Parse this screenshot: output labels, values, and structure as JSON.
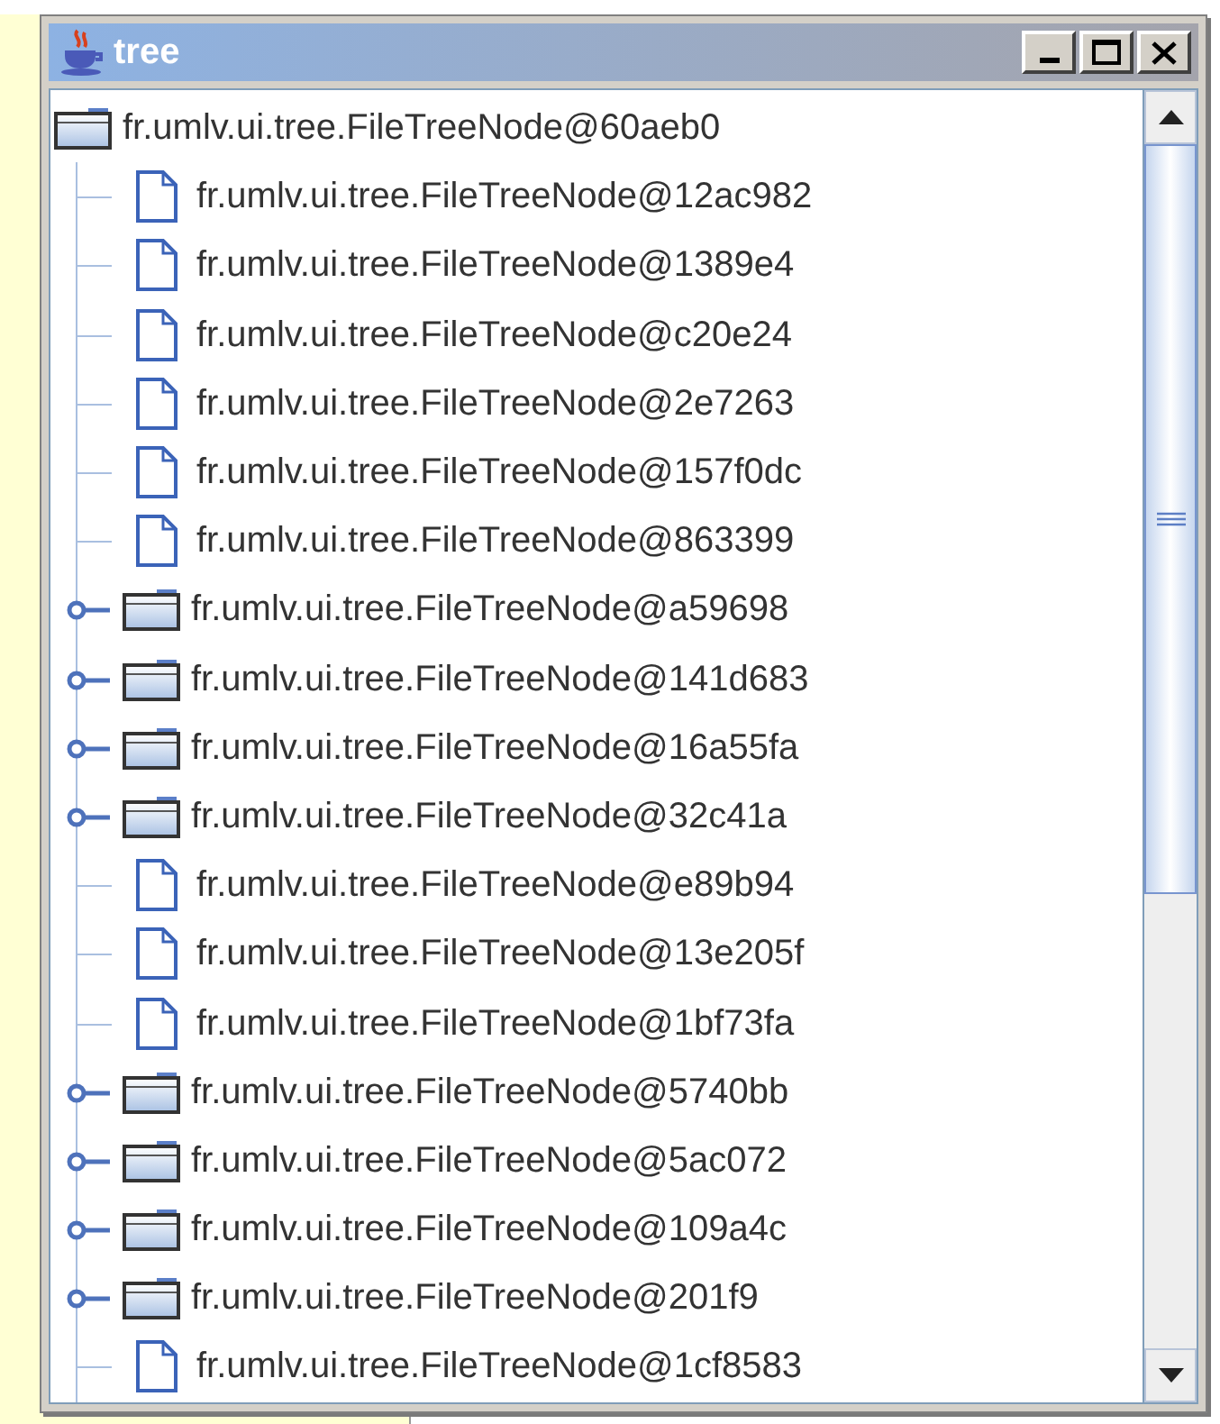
{
  "window": {
    "title": "tree"
  },
  "tree": {
    "root": {
      "label": "fr.umlv.ui.tree.FileTreeNode@60aeb0",
      "kind": "folder",
      "expanded": true,
      "children": [
        {
          "label": "fr.umlv.ui.tree.FileTreeNode@12ac982",
          "kind": "file"
        },
        {
          "label": "fr.umlv.ui.tree.FileTreeNode@1389e4",
          "kind": "file"
        },
        {
          "label": "fr.umlv.ui.tree.FileTreeNode@c20e24",
          "kind": "file"
        },
        {
          "label": "fr.umlv.ui.tree.FileTreeNode@2e7263",
          "kind": "file"
        },
        {
          "label": "fr.umlv.ui.tree.FileTreeNode@157f0dc",
          "kind": "file"
        },
        {
          "label": "fr.umlv.ui.tree.FileTreeNode@863399",
          "kind": "file"
        },
        {
          "label": "fr.umlv.ui.tree.FileTreeNode@a59698",
          "kind": "folder",
          "expanded": false
        },
        {
          "label": "fr.umlv.ui.tree.FileTreeNode@141d683",
          "kind": "folder",
          "expanded": false
        },
        {
          "label": "fr.umlv.ui.tree.FileTreeNode@16a55fa",
          "kind": "folder",
          "expanded": false
        },
        {
          "label": "fr.umlv.ui.tree.FileTreeNode@32c41a",
          "kind": "folder",
          "expanded": false
        },
        {
          "label": "fr.umlv.ui.tree.FileTreeNode@e89b94",
          "kind": "file"
        },
        {
          "label": "fr.umlv.ui.tree.FileTreeNode@13e205f",
          "kind": "file"
        },
        {
          "label": "fr.umlv.ui.tree.FileTreeNode@1bf73fa",
          "kind": "file"
        },
        {
          "label": "fr.umlv.ui.tree.FileTreeNode@5740bb",
          "kind": "folder",
          "expanded": false
        },
        {
          "label": "fr.umlv.ui.tree.FileTreeNode@5ac072",
          "kind": "folder",
          "expanded": false
        },
        {
          "label": "fr.umlv.ui.tree.FileTreeNode@109a4c",
          "kind": "folder",
          "expanded": false
        },
        {
          "label": "fr.umlv.ui.tree.FileTreeNode@201f9",
          "kind": "folder",
          "expanded": false
        },
        {
          "label": "fr.umlv.ui.tree.FileTreeNode@1cf8583",
          "kind": "file"
        }
      ]
    }
  }
}
